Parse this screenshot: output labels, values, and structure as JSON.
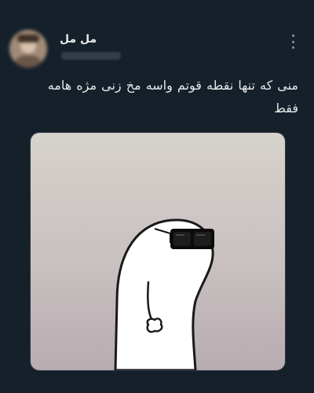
{
  "author": {
    "display_name": "مل مل"
  },
  "tweet": {
    "text_line_1": "منی که تنها نقطه قوتم واسه مخ زنی مژه هامه",
    "text_line_2": "فقط"
  },
  "icons": {
    "more": "more-vertical-icon"
  },
  "colors": {
    "background": "#15202b",
    "text": "#e7e9ea",
    "muted": "#8b98a5"
  }
}
